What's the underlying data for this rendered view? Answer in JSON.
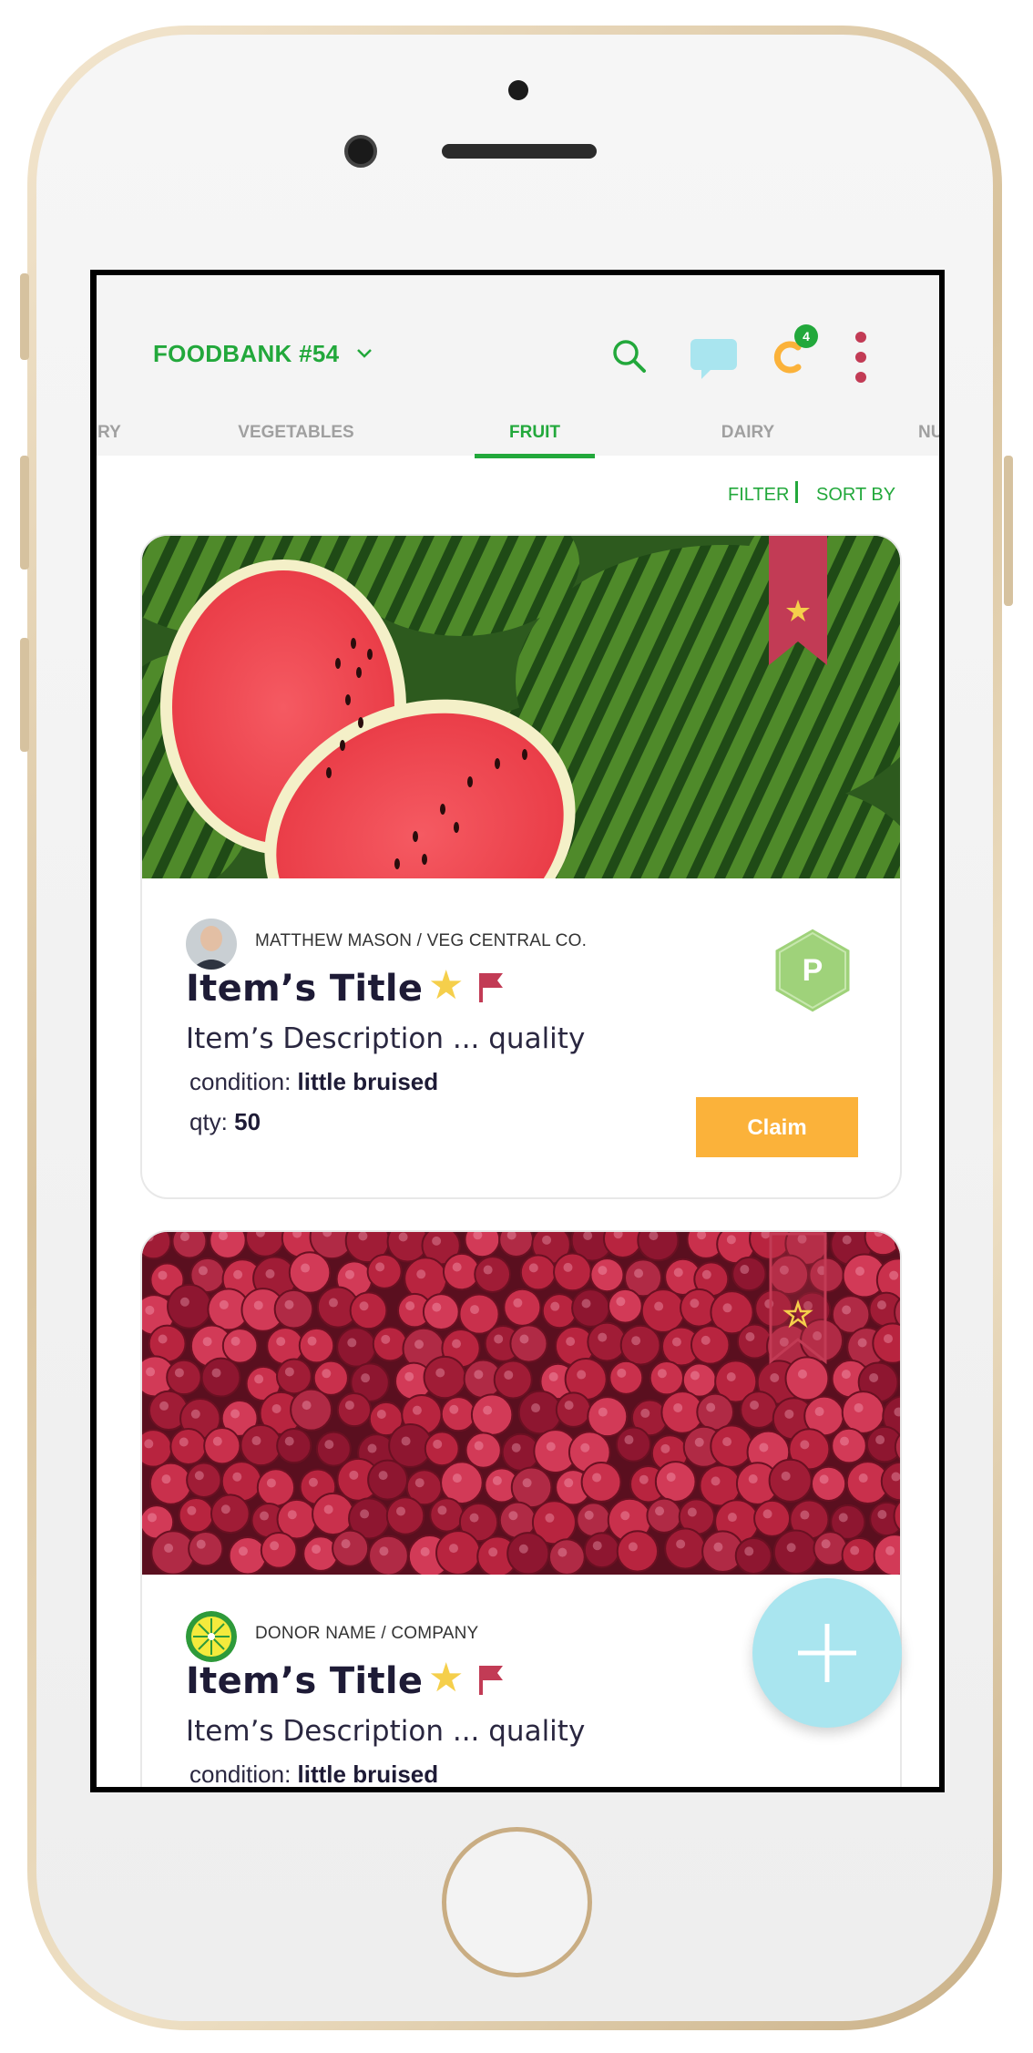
{
  "app": {
    "title": "FOODBANK #54",
    "credits_badge": "4"
  },
  "tabs": [
    {
      "label": "RY"
    },
    {
      "label": "VEGETABLES"
    },
    {
      "label": "FRUIT",
      "active": true
    },
    {
      "label": "DAIRY"
    },
    {
      "label": "NU"
    }
  ],
  "toolbar": {
    "filter_label": "FILTER",
    "sort_label": "SORT BY"
  },
  "items": [
    {
      "image": "watermelon-photo",
      "bookmarked": true,
      "donor_name": "MATTHEW MASON",
      "donor_company": "VEG CENTRAL CO.",
      "title": "Item’s Title",
      "description": "Item’s Description ... quality",
      "condition_label": "condition:",
      "condition_value": "little bruised",
      "qty_label": "qty:",
      "qty_value": "50",
      "badge_letter": "P",
      "claim_label": "Claim"
    },
    {
      "image": "raspberry-photo",
      "bookmarked": false,
      "donor_name": "DONOR NAME",
      "donor_company": "COMPANY",
      "title": "Item’s Title",
      "description": "Item’s Description ... quality",
      "condition_label": "condition:",
      "condition_value": "little bruised"
    }
  ],
  "colors": {
    "brand_green": "#22a83b",
    "claim_orange": "#fbb23a",
    "bookmark_red": "#c23b55",
    "fab_cyan": "#a9e5ef",
    "star_yellow": "#f5cf4b"
  },
  "icons": [
    "search-icon",
    "chat-icon",
    "credits-icon",
    "more-vertical-icon",
    "chevron-down-icon",
    "bookmark-icon",
    "star-icon",
    "flag-icon",
    "plus-icon"
  ]
}
